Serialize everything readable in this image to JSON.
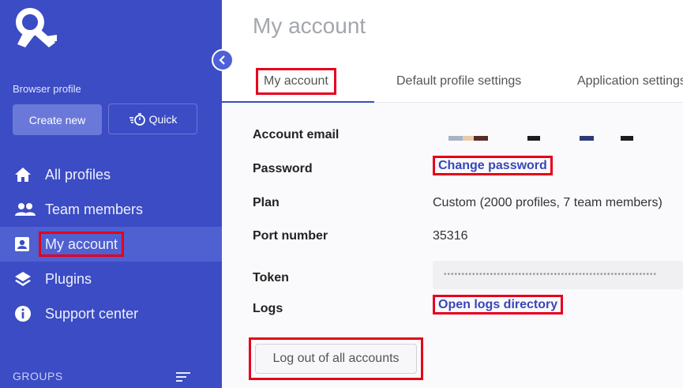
{
  "sidebar": {
    "section_label": "Browser profile",
    "create_new_label": "Create new",
    "quick_label": "Quick",
    "nav": [
      {
        "label": "All profiles",
        "icon": "home-icon"
      },
      {
        "label": "Team members",
        "icon": "people-icon"
      },
      {
        "label": "My account",
        "icon": "account-box-icon",
        "active": true
      },
      {
        "label": "Plugins",
        "icon": "layers-icon"
      },
      {
        "label": "Support center",
        "icon": "info-icon"
      }
    ],
    "groups_label": "GROUPS"
  },
  "main": {
    "title": "My account",
    "tabs": [
      {
        "label": "My account",
        "active": true
      },
      {
        "label": "Default profile settings"
      },
      {
        "label": "Application settings"
      }
    ],
    "rows": {
      "email_label": "Account email",
      "password_label": "Password",
      "password_link": "Change password",
      "plan_label": "Plan",
      "plan_value": "Custom (2000 profiles, 7 team members)",
      "port_label": "Port number",
      "port_value": "35316",
      "token_label": "Token",
      "token_value": "••••••••••••••••••••••••••••••••••••••••••••••••••••••••••••",
      "logs_label": "Logs",
      "logs_link": "Open logs directory"
    },
    "logout_label": "Log out of all accounts"
  },
  "colors": {
    "sidebar_bg": "#3b4cc4",
    "accent": "#3846b8",
    "highlight_box": "#e6001a"
  }
}
